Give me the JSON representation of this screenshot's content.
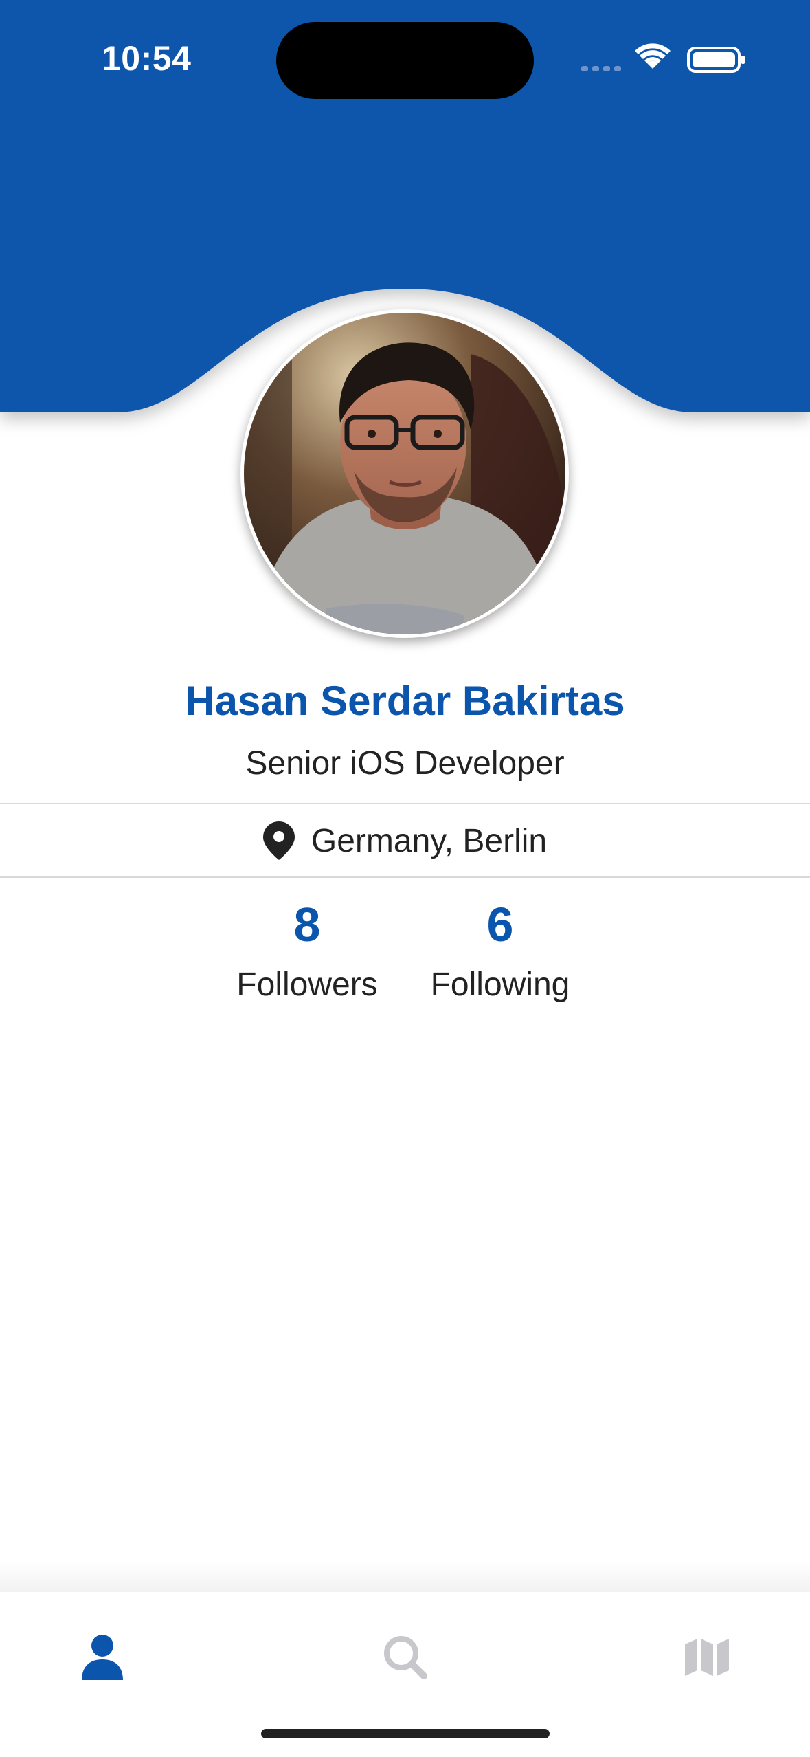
{
  "status_bar": {
    "time": "10:54"
  },
  "profile": {
    "name": "Hasan Serdar Bakirtas",
    "title": "Senior iOS Developer",
    "location": "Germany, Berlin",
    "location_icon": "map-pin-icon",
    "avatar_icon": "profile-photo"
  },
  "stats": {
    "followers": {
      "count": "8",
      "label": "Followers"
    },
    "following": {
      "count": "6",
      "label": "Following"
    }
  },
  "tab_bar": {
    "selected": "profile",
    "tabs": [
      {
        "id": "profile",
        "icon": "person-icon"
      },
      {
        "id": "search",
        "icon": "search-icon"
      },
      {
        "id": "map",
        "icon": "map-icon"
      }
    ]
  },
  "colors": {
    "brand_blue": "#0b56ac",
    "text_dark": "#222222",
    "tab_inactive": "#c7c7cc"
  }
}
